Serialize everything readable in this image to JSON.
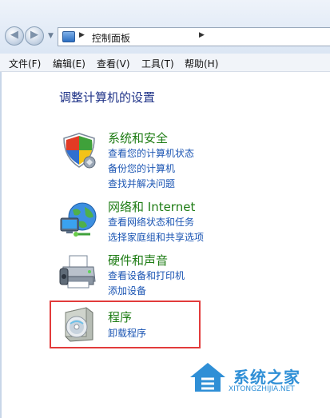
{
  "address_bar": {
    "breadcrumb": "控制面板",
    "icons": [
      "back-arrow-icon",
      "forward-arrow-icon",
      "chevron-down-icon",
      "control-panel-icon",
      "chevron-right-icon"
    ]
  },
  "menu": {
    "items": [
      {
        "label": "文件(F)"
      },
      {
        "label": "编辑(E)"
      },
      {
        "label": "查看(V)"
      },
      {
        "label": "工具(T)"
      },
      {
        "label": "帮助(H)"
      }
    ]
  },
  "heading": "调整计算机的设置",
  "categories": [
    {
      "title": "系统和安全",
      "icon": "security-shield-icon",
      "links": [
        "查看您的计算机状态",
        "备份您的计算机",
        "查找并解决问题"
      ]
    },
    {
      "title": "网络和 Internet",
      "icon": "network-globe-icon",
      "links": [
        "查看网络状态和任务",
        "选择家庭组和共享选项"
      ]
    },
    {
      "title": "硬件和声音",
      "icon": "printer-icon",
      "links": [
        "查看设备和打印机",
        "添加设备"
      ]
    },
    {
      "title": "程序",
      "icon": "programs-disc-icon",
      "links": [
        "卸载程序"
      ]
    }
  ],
  "colors": {
    "heading": "#1e3287",
    "category_title": "#1e7c14",
    "link": "#1b55b3",
    "highlight_border": "#e23b3b"
  },
  "watermark": {
    "main": "系统之家",
    "sub": "XITONGZHIJIA.NET"
  }
}
